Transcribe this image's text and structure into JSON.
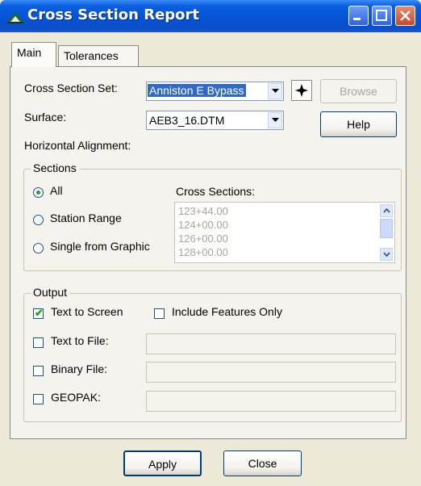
{
  "window": {
    "title": "Cross Section Report"
  },
  "tabs": [
    {
      "label": "Main",
      "active": true
    },
    {
      "label": "Tolerances",
      "active": false
    }
  ],
  "fields": {
    "cross_section_set": {
      "label": "Cross Section Set:",
      "value": "Anniston E Bypass"
    },
    "surface": {
      "label": "Surface:",
      "value": "AEB3_16.DTM"
    },
    "horizontal_alignment": {
      "label": "Horizontal Alignment:"
    }
  },
  "buttons": {
    "browse": "Browse",
    "help": "Help",
    "apply": "Apply",
    "close": "Close"
  },
  "sections": {
    "title": "Sections",
    "options": [
      {
        "label": "All",
        "selected": true
      },
      {
        "label": "Station Range",
        "selected": false
      },
      {
        "label": "Single from Graphic",
        "selected": false
      }
    ],
    "list_label": "Cross Sections:",
    "list_items": [
      "123+44.00",
      "124+00.00",
      "126+00.00",
      "128+00.00"
    ]
  },
  "output": {
    "title": "Output",
    "text_to_screen": {
      "label": "Text to Screen",
      "checked": true
    },
    "include_features_only": {
      "label": "Include Features Only",
      "checked": false
    },
    "text_to_file": {
      "label": "Text to File:",
      "checked": false,
      "value": ""
    },
    "binary_file": {
      "label": "Binary File:",
      "checked": false,
      "value": ""
    },
    "geopak": {
      "label": "GEOPAK:",
      "checked": false,
      "value": ""
    }
  },
  "icons": {
    "app": "cross-section-app-icon",
    "star": "star-target-icon"
  },
  "colors": {
    "titlebar": "#0652d6",
    "selection": "#316ac5",
    "window_bg": "#ece9d8",
    "check_green": "#21a121"
  }
}
